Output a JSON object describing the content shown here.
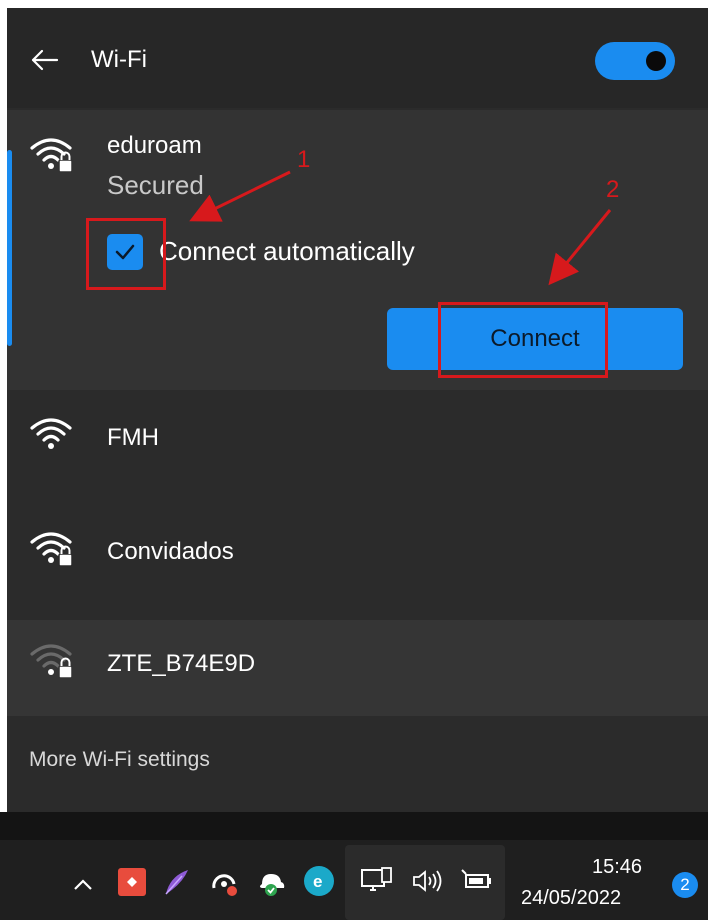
{
  "header": {
    "title": "Wi-Fi",
    "wifi_enabled": true
  },
  "networks": [
    {
      "name": "eduroam",
      "status": "Secured",
      "secured": true,
      "expanded": true
    },
    {
      "name": "FMH",
      "secured": false
    },
    {
      "name": "Convidados",
      "secured": true
    },
    {
      "name": "ZTE_B74E9D",
      "secured": true
    }
  ],
  "expanded_network": {
    "connect_automatically_label": "Connect automatically",
    "connect_automatically_checked": true,
    "connect_button": "Connect"
  },
  "footer": {
    "more_settings": "More Wi-Fi settings"
  },
  "annotations": {
    "step1": "1",
    "step2": "2"
  },
  "taskbar": {
    "time": "15:46",
    "date": "24/05/2022",
    "notification_count": "2",
    "tray_icons": [
      "chevron-up-icon",
      "app-red-icon",
      "feather-icon",
      "cloud-sync-icon",
      "cloud-check-icon",
      "eset-icon",
      "network-icon",
      "volume-icon",
      "battery-icon"
    ]
  },
  "colors": {
    "accent": "#1a8cf0",
    "annotation": "#d7191c",
    "panel": "#2b2b2b"
  }
}
